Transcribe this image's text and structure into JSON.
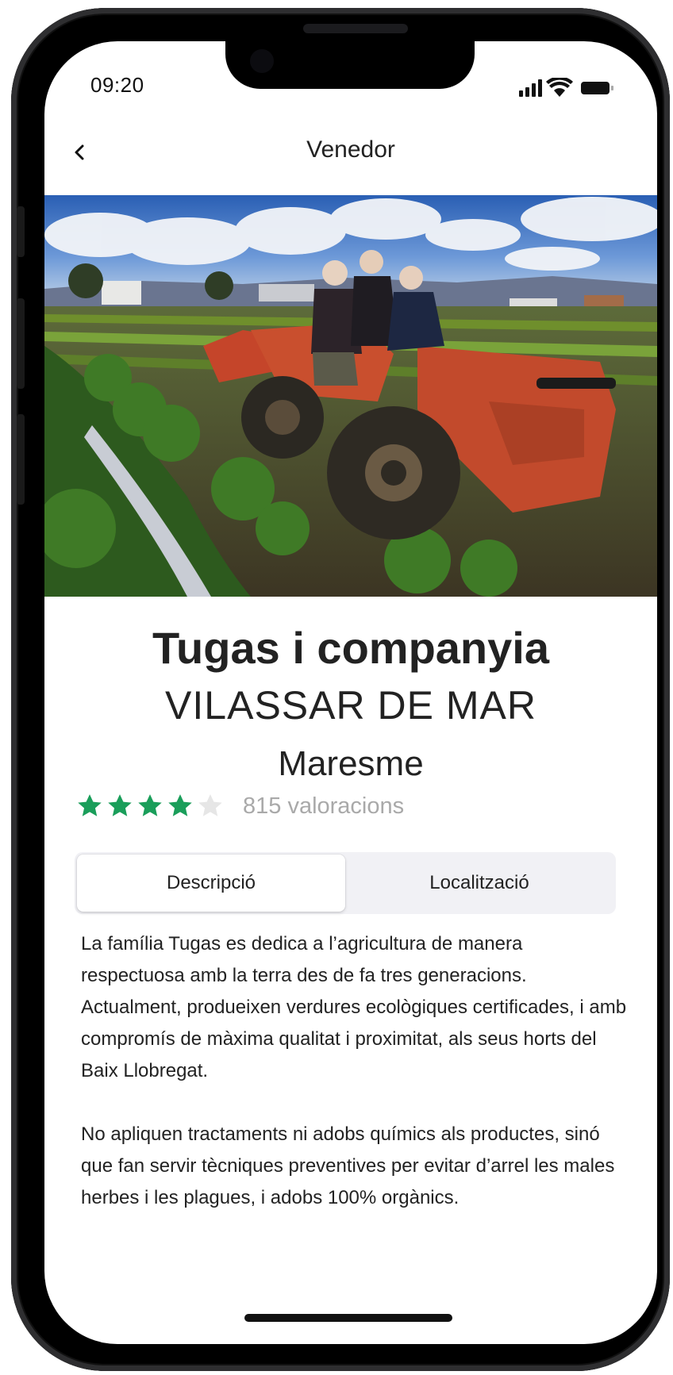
{
  "status_bar": {
    "time": "09:20"
  },
  "header": {
    "title": "Venedor",
    "back_icon": "chevron-left-icon"
  },
  "hero_image": {
    "alt": ""
  },
  "vendor": {
    "name": "Tugas i companyia",
    "city": "VILASSAR DE MAR",
    "region": "Maresme",
    "rating": 4,
    "rating_max": 5,
    "reviews": "815 valoracions"
  },
  "tabs": [
    {
      "label": "Descripció",
      "active": true
    },
    {
      "label": "Localització",
      "active": false
    }
  ],
  "description": [
    "La família Tugas es dedica a l’agricultura de manera respectuosa amb la terra des de fa tres generacions. Actualment, produeixen verdures ecològiques certificades, i amb compromís de màxima qualitat i proximitat, als seus horts del Baix Llobregat.",
    "No apliquen tractaments ni adobs químics als productes, sinó que fan servir tècniques preventives per evitar d’arrel les males herbes i les plagues, i adobs 100% orgànics."
  ],
  "colors": {
    "star_filled": "#1a9e5a",
    "star_empty": "#e6e6e6",
    "tab_track": "#f1f1f5",
    "text": "#222222"
  }
}
